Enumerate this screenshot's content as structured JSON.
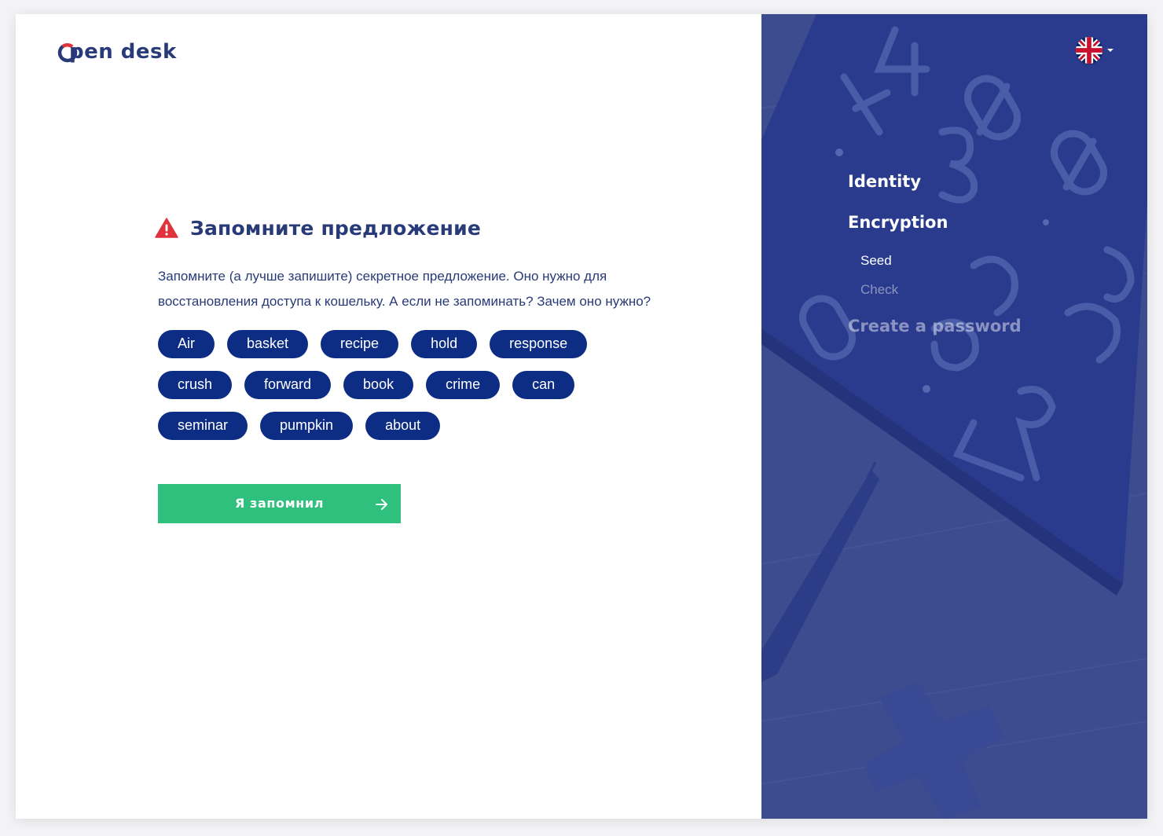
{
  "app": {
    "logo_text": "pen desk",
    "colors": {
      "brand": "#283a78",
      "accent_red": "#e0323c",
      "pill": "#0d2d84",
      "primary_button": "#2fc07e",
      "sidebar": "#3a4a92"
    }
  },
  "main": {
    "title": "Запомните предложение",
    "warning_icon": "warning-triangle-icon",
    "description": "Запомните (а лучше запишите) секретное предложение. Оно нужно для восстановления доступа к кошельку. А если не запоминать? Зачем оно нужно?",
    "seed_words": [
      "Air",
      "basket",
      "recipe",
      "hold",
      "response",
      "crush",
      "forward",
      "book",
      "crime",
      "can",
      "seminar",
      "pumpkin",
      "about"
    ],
    "confirm_button": {
      "label": "Я запомнил",
      "icon": "arrow-right-icon"
    }
  },
  "sidebar": {
    "language_icon": "uk-flag-icon",
    "steps": [
      {
        "label": "Identity",
        "state": "done"
      },
      {
        "label": "Encryption",
        "state": "active",
        "substeps": [
          {
            "label": "Seed",
            "state": "active"
          },
          {
            "label": "Check",
            "state": "pending"
          }
        ]
      },
      {
        "label": "Create a password",
        "state": "pending"
      }
    ]
  }
}
